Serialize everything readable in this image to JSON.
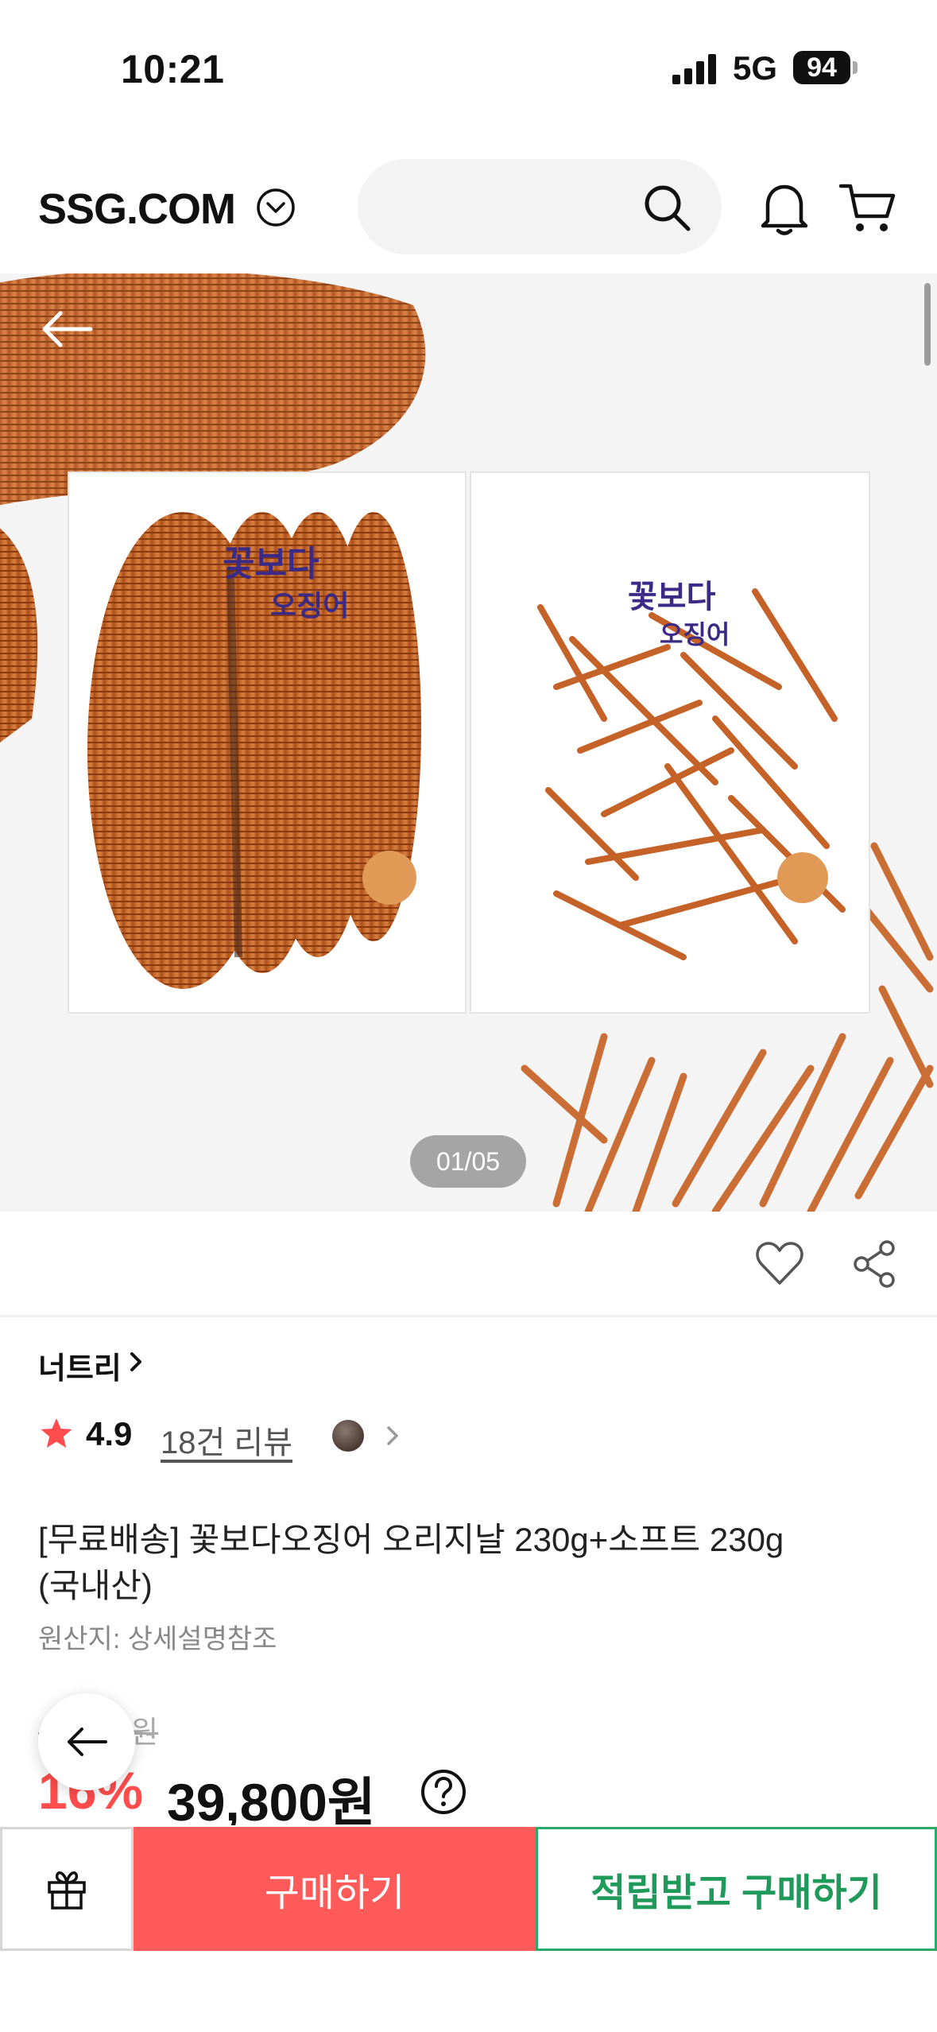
{
  "status_bar": {
    "time": "10:21",
    "network": "5G",
    "battery": "94"
  },
  "header": {
    "logo": "SSG.COM"
  },
  "gallery": {
    "counter": "01/05"
  },
  "product": {
    "brand": "너트리",
    "rating": "4.9",
    "review_count": "18건 리뷰",
    "title": "[무료배송] 꽃보다오징어 오리지날 230g+소프트 230g (국내산)",
    "origin": "원산지: 상세설명참조",
    "original_price": "47,000원",
    "discount": "16%",
    "price": "39,800원"
  },
  "bottom_bar": {
    "buy_label": "구매하기",
    "points_buy_label": "적립받고 구매하기"
  },
  "colors": {
    "discount": "#ff4c4c",
    "buy_button": "#ff5a5a",
    "points_button": "#1f9a5b"
  }
}
